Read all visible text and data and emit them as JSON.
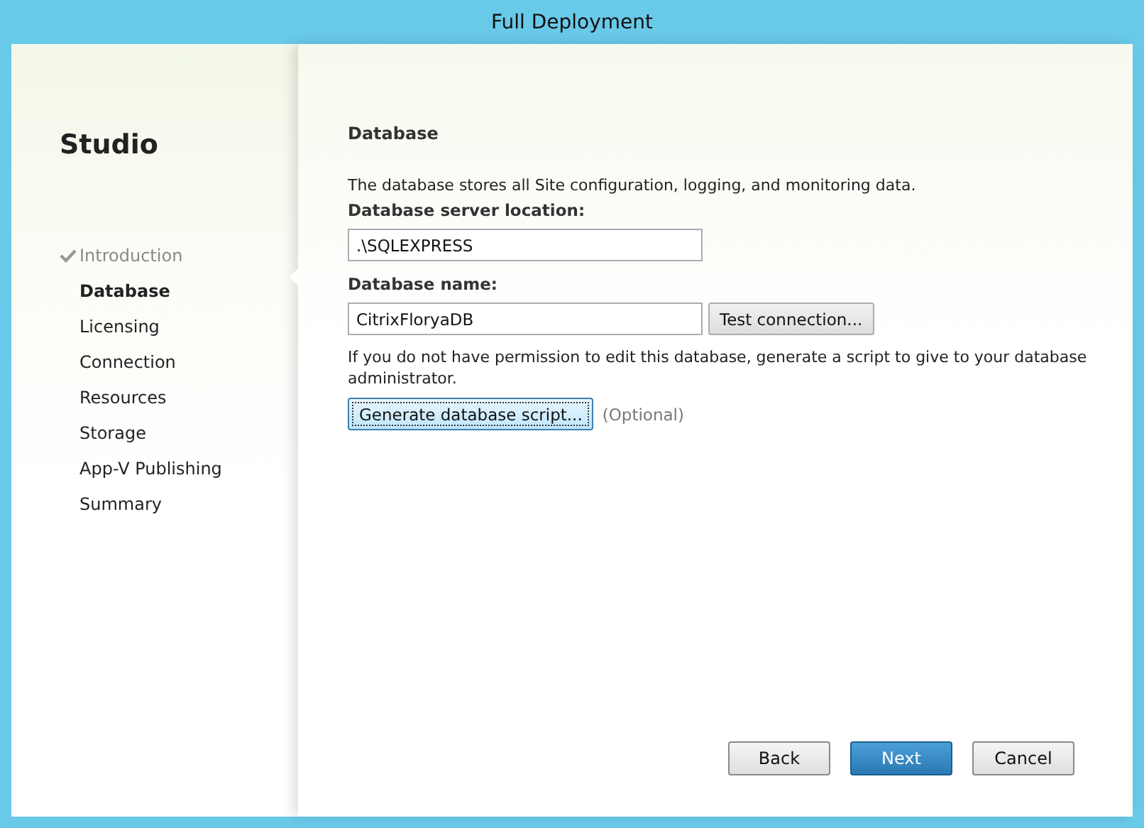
{
  "window": {
    "title": "Full Deployment"
  },
  "sidebar": {
    "title": "Studio",
    "steps": [
      {
        "label": "Introduction",
        "completed": true,
        "selected": false
      },
      {
        "label": "Database",
        "completed": false,
        "selected": true
      },
      {
        "label": "Licensing",
        "completed": false,
        "selected": false
      },
      {
        "label": "Connection",
        "completed": false,
        "selected": false
      },
      {
        "label": "Resources",
        "completed": false,
        "selected": false
      },
      {
        "label": "Storage",
        "completed": false,
        "selected": false
      },
      {
        "label": "App-V Publishing",
        "completed": false,
        "selected": false
      },
      {
        "label": "Summary",
        "completed": false,
        "selected": false
      }
    ]
  },
  "page": {
    "heading": "Database",
    "description": "The database stores all Site configuration, logging, and monitoring data.",
    "server_label": "Database server location:",
    "server_value": ".\\SQLEXPRESS",
    "name_label": "Database name:",
    "name_value": "CitrixFloryaDB",
    "test_button": "Test connection...",
    "permission_note": "If you do not have permission to edit this database, generate a script to give to your database administrator.",
    "script_button": "Generate database script...",
    "optional_note": "(Optional)"
  },
  "buttons": [
    {
      "label": "Back",
      "primary": false
    },
    {
      "label": "Next",
      "primary": true
    },
    {
      "label": "Cancel",
      "primary": false
    }
  ]
}
